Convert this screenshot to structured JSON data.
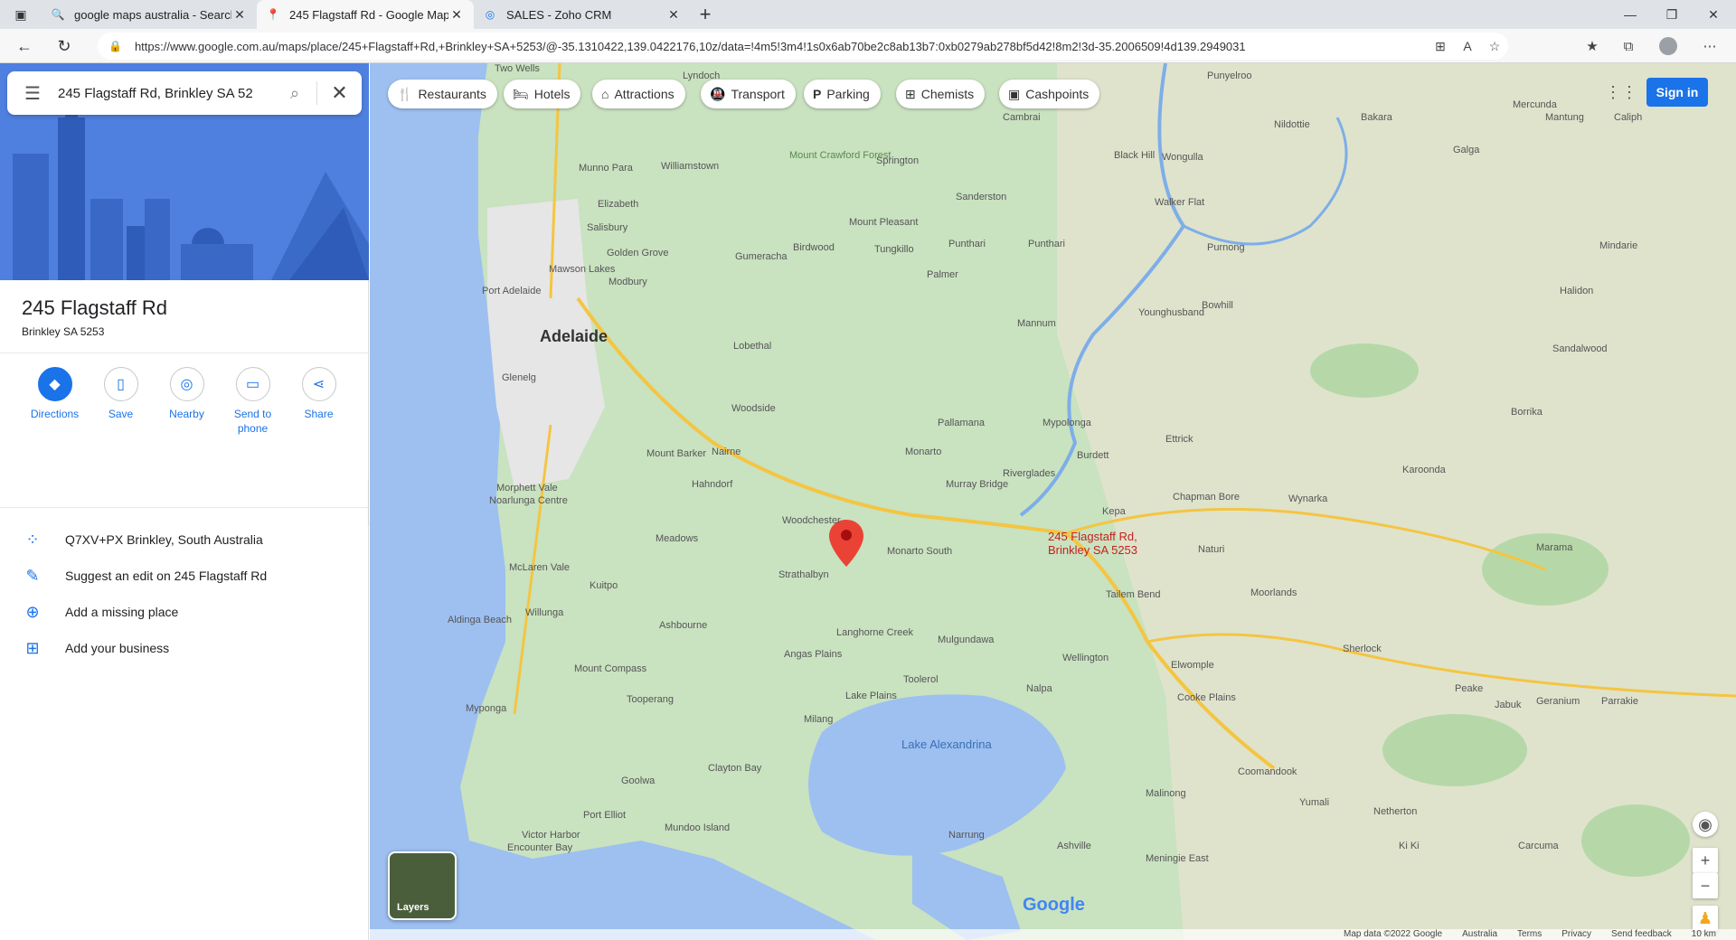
{
  "browser": {
    "tabs": [
      {
        "title": "google maps australia - Search",
        "icon": "search-icon"
      },
      {
        "title": "245 Flagstaff Rd - Google Maps",
        "icon": "maps-pin-icon",
        "active": true
      },
      {
        "title": "SALES - Zoho CRM",
        "icon": "zoho-icon"
      }
    ],
    "url": "https://www.google.com.au/maps/place/245+Flagstaff+Rd,+Brinkley+SA+5253/@-35.1310422,139.0422176,10z/data=!4m5!3m4!1s0x6ab70be2c8ab13b7:0xb0279ab278bf5d42!8m2!3d-35.2006509!4d139.2949031"
  },
  "search": {
    "query": "245 Flagstaff Rd, Brinkley SA 52"
  },
  "place": {
    "title": "245 Flagstaff Rd",
    "subtitle": "Brinkley SA 5253"
  },
  "actions": [
    {
      "label": "Directions",
      "icon": "directions-icon"
    },
    {
      "label": "Save",
      "icon": "bookmark-icon"
    },
    {
      "label": "Nearby",
      "icon": "nearby-icon"
    },
    {
      "label": "Send to phone",
      "icon": "phone-icon"
    },
    {
      "label": "Share",
      "icon": "share-icon"
    }
  ],
  "info": [
    {
      "text": "Q7XV+PX Brinkley, South Australia",
      "icon": "plus-code-icon"
    },
    {
      "text": "Suggest an edit on 245 Flagstaff Rd",
      "icon": "edit-icon"
    },
    {
      "text": "Add a missing place",
      "icon": "add-place-icon"
    },
    {
      "text": "Add your business",
      "icon": "add-business-icon"
    }
  ],
  "map": {
    "chips": [
      {
        "label": "Restaurants",
        "icon": "restaurant-icon"
      },
      {
        "label": "Hotels",
        "icon": "hotel-icon"
      },
      {
        "label": "Attractions",
        "icon": "attractions-icon"
      },
      {
        "label": "Transport",
        "icon": "transport-icon"
      },
      {
        "label": "Parking",
        "icon": "parking-icon"
      },
      {
        "label": "Chemists",
        "icon": "chemist-icon"
      },
      {
        "label": "Cashpoints",
        "icon": "cashpoint-icon"
      }
    ],
    "sign_in": "Sign in",
    "pin_label_line1": "245 Flagstaff Rd,",
    "pin_label_line2": "Brinkley SA 5253",
    "layers": "Layers",
    "logo": "Google",
    "labels": {
      "adelaide": "Adelaide",
      "lake": "Lake Alexandrina",
      "murray_bridge": "Murray Bridge",
      "mount_barker": "Mount Barker",
      "hahndorf": "Hahndorf",
      "victor_harbor": "Victor Harbor",
      "goolwa": "Goolwa",
      "strathalbyn": "Strathalbyn",
      "tailem_bend": "Tailem Bend",
      "wellington": "Wellington",
      "meningie": "Meningie East",
      "mannum": "Mannum",
      "monarto": "Monarto",
      "elizabeth": "Elizabeth",
      "port_adelaide": "Port Adelaide",
      "coomandook": "Coomandook",
      "karoonda": "Karoonda",
      "lobethal": "Lobethal",
      "woodside": "Woodside",
      "nairne": "Nairne",
      "noarlunga": "Noarlunga Centre",
      "mclaren": "McLaren Vale",
      "milang": "Milang",
      "langhorne": "Langhorne Creek",
      "kepa": "Kepa",
      "naturi": "Naturi",
      "moorlands": "Moorlands",
      "sherlock": "Sherlock",
      "elwomple": "Elwomple",
      "cooke_plains": "Cooke Plains",
      "nalpa": "Nalpa",
      "mulgundawa": "Mulgundawa",
      "palmer": "Palmer",
      "tungkillo": "Tungkillo",
      "gumeracha": "Gumeracha",
      "birdwood": "Birdwood",
      "mount_pleasant": "Mount Pleasant",
      "sanderston": "Sanderston",
      "punthari": "Punthari",
      "black_hill": "Black Hill",
      "walker_flat": "Walker Flat",
      "purnong": "Purnong",
      "bowhill": "Bowhill",
      "younghusband": "Younghusband",
      "ettrick": "Ettrick",
      "burdett": "Burdett",
      "mypolonga": "Mypolonga",
      "pallamana": "Pallamana",
      "riverglades": "Riverglades",
      "chapman_bore": "Chapman Bore",
      "wynarka": "Wynarka",
      "marama": "Marama",
      "borrika": "Borrika",
      "sandalwood": "Sandalwood",
      "halidon": "Halidon",
      "mindarie": "Mindarie",
      "galga": "Galga",
      "bakara": "Bakara",
      "nildottie": "Nildottie",
      "wongulla": "Wongulla",
      "mercunda": "Mercunda",
      "mantung": "Mantung",
      "caliph": "Caliph",
      "punyelroo": "Punyelroo",
      "cambrai": "Cambrai",
      "ashbourne": "Ashbourne",
      "meadows": "Meadows",
      "kuitpo": "Kuitpo",
      "willunga": "Willunga",
      "aldinga": "Aldinga Beach",
      "mount_compass": "Mount Compass",
      "tooperang": "Tooperang",
      "myponga": "Myponga",
      "clayton_bay": "Clayton Bay",
      "port_elliot": "Port Elliot",
      "mundoo": "Mundoo Island",
      "encounter_bay": "Encounter Bay",
      "narrung": "Narrung",
      "ashville": "Ashville",
      "malinong": "Malinong",
      "yumali": "Yumali",
      "netherton": "Netherton",
      "peake": "Peake",
      "jabuk": "Jabuk",
      "geranium": "Geranium",
      "parrakie": "Parrakie",
      "carcuma": "Carcuma",
      "ki_ki": "Ki Ki",
      "monarto_south": "Monarto South",
      "woodchester": "Woodchester",
      "angas_plains": "Angas Plains",
      "lake_plains": "Lake Plains",
      "toolerol": "Toolerol",
      "salisbury": "Salisbury",
      "golden_grove": "Golden Grove",
      "mawson_lakes": "Mawson Lakes",
      "modbury": "Modbury",
      "glenelg": "Glenelg",
      "morphett_vale": "Morphett Vale",
      "springton": "Springton",
      "williamstown": "Williamstown",
      "munno_para": "Munno Para",
      "two_wells": "Two Wells",
      "lyndoch": "Lyndoch",
      "mount_crawford": "Mount Crawford Forest"
    },
    "footer": [
      "Map data ©2022 Google",
      "Australia",
      "Terms",
      "Privacy",
      "Send feedback",
      "10 km"
    ]
  },
  "colors": {
    "accent": "#1a73e8",
    "land": "#c9e2c0",
    "water": "#9dc0f0",
    "urban": "#e8e8e8",
    "pin": "#ea4335"
  }
}
